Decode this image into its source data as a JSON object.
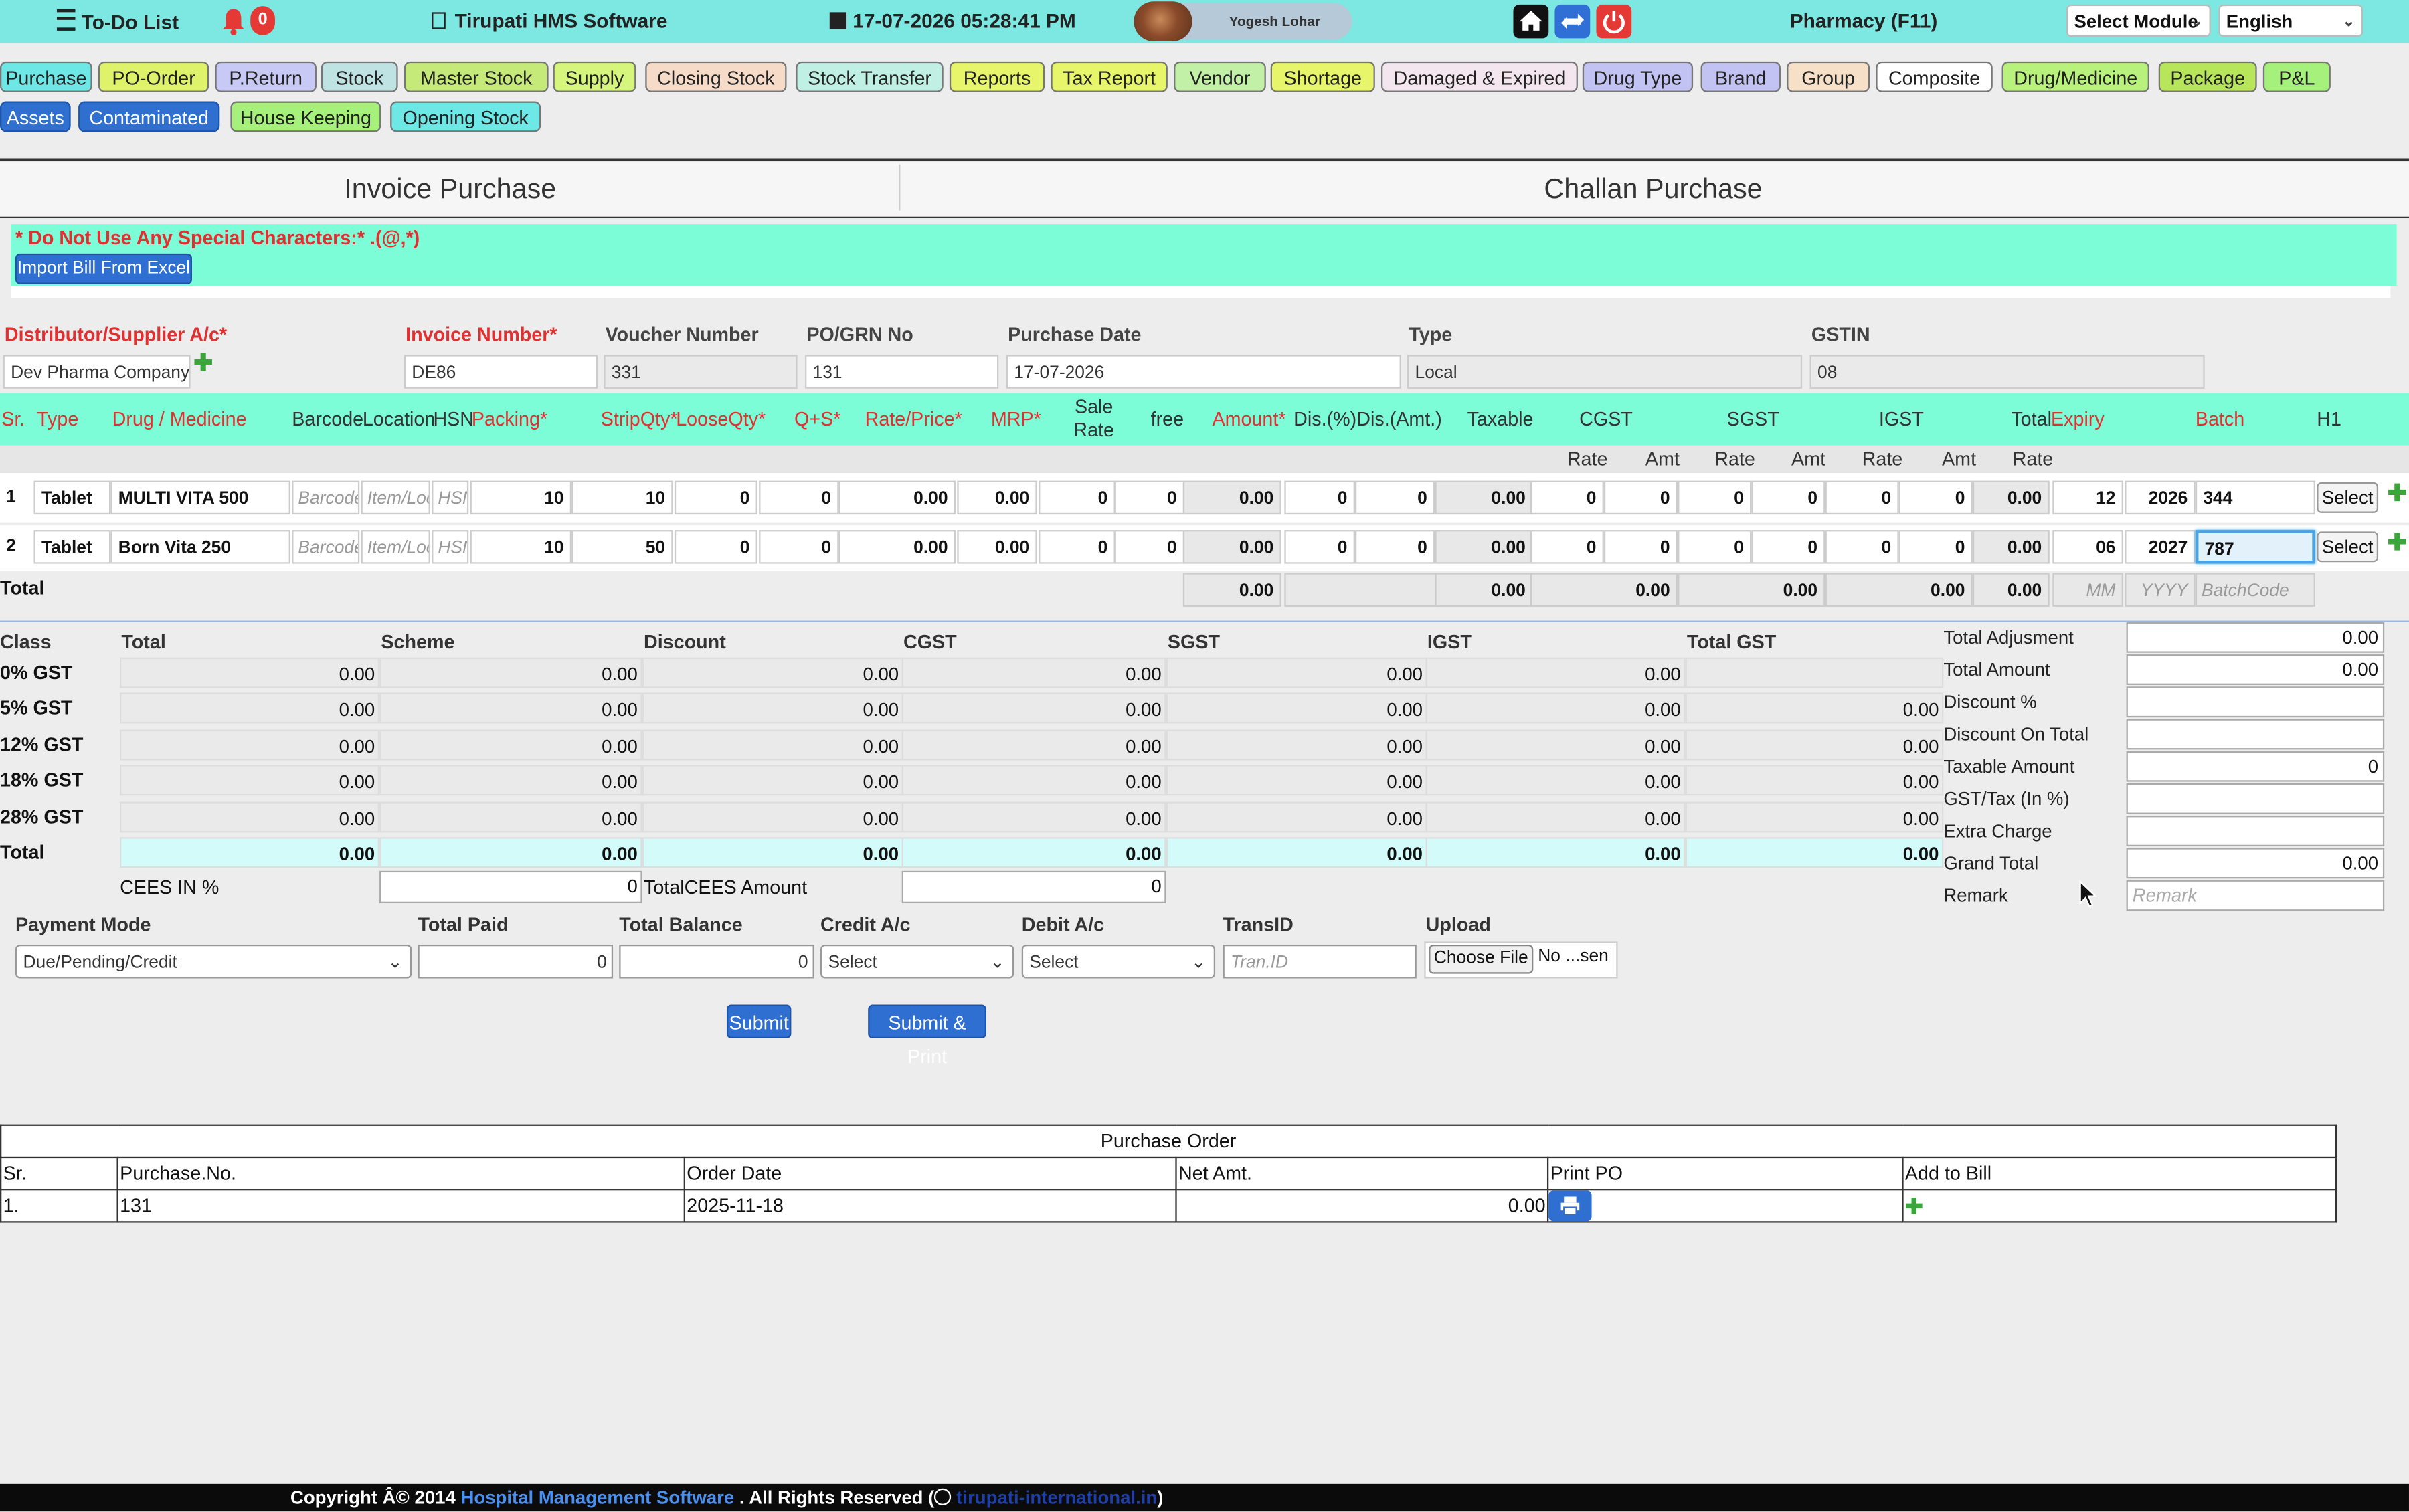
{
  "topbar": {
    "todo_label": "To-Do List",
    "notif_count": "0",
    "app_name": "Tirupati HMS Software",
    "datetime": "17-07-2026 05:28:41 PM",
    "user_name": "Yogesh Lohar",
    "module_title": "Pharmacy (F11)",
    "select_module": "Select Module",
    "language": "English"
  },
  "nav": {
    "row1": [
      {
        "label": "Purchase",
        "color": "#6ee8e6"
      },
      {
        "label": "PO-Order",
        "color": "#dff36a"
      },
      {
        "label": "P.Return",
        "color": "#c9c9f5"
      },
      {
        "label": "Stock",
        "color": "#bfe3e3"
      },
      {
        "label": "Master Stock",
        "color": "#c6ea7a"
      },
      {
        "label": "Supply",
        "color": "#d6f57c"
      },
      {
        "label": "Closing Stock",
        "color": "#f6dcc8"
      },
      {
        "label": "Stock Transfer",
        "color": "#bff0e3"
      },
      {
        "label": "Reports",
        "color": "#e6f56a"
      },
      {
        "label": "Tax Report",
        "color": "#e6f56a"
      },
      {
        "label": "Vendor",
        "color": "#c2f0a6"
      },
      {
        "label": "Shortage",
        "color": "#e6f56a"
      },
      {
        "label": "Damaged & Expired",
        "color": "#f3e6ef"
      },
      {
        "label": "Drug Type",
        "color": "#c3c3f3"
      },
      {
        "label": "Brand",
        "color": "#c3c3f3"
      },
      {
        "label": "Group",
        "color": "#f6e0c8"
      },
      {
        "label": "Composite",
        "color": "#ffffff"
      },
      {
        "label": "Drug/Medicine",
        "color": "#b8f27c"
      },
      {
        "label": "Package",
        "color": "#b8e65a"
      },
      {
        "label": "P&L",
        "color": "#a6f07c"
      }
    ],
    "row2": [
      {
        "label": "Assets",
        "color": "#2f6fcf"
      },
      {
        "label": "Contaminated",
        "color": "#2f6fcf"
      },
      {
        "label": "House Keeping",
        "color": "#a6f07c"
      },
      {
        "label": "Opening Stock",
        "color": "#6ee8e6"
      }
    ]
  },
  "tabs": {
    "invoice": "Invoice Purchase",
    "challan": "Challan Purchase"
  },
  "notice": {
    "text": "* Do Not Use Any Special Characters:* .(@,*)",
    "import_btn": "Import Bill From Excel"
  },
  "form": {
    "distributor_label": "Distributor/Supplier A/c*",
    "distributor_value": "Dev Pharma Company P",
    "invoice_label": "Invoice Number*",
    "invoice_value": "DE86",
    "voucher_label": "Voucher Number",
    "voucher_value": "331",
    "po_label": "PO/GRN No",
    "po_value": "131",
    "date_label": "Purchase Date",
    "date_value": "17-07-2026",
    "type_label": "Type",
    "type_value": "Local",
    "gstin_label": "GSTIN",
    "gstin_value": "08"
  },
  "grid": {
    "headers": {
      "sr": "Sr.",
      "type": "Type",
      "drug": "Drug / Medicine",
      "barcode": "Barcode",
      "location": "Location",
      "hsn": "HSN",
      "packing": "Packing*",
      "strip": "StripQty*",
      "loose": "LooseQty*",
      "qs": "Q+S*",
      "rate": "Rate/Price*",
      "mrp": "MRP*",
      "sale_rate": "Sale Rate",
      "free": "free",
      "amount": "Amount*",
      "disp": "Dis.(%)",
      "disamt": "Dis.(Amt.)",
      "taxable": "Taxable",
      "cgst": "CGST",
      "sgst": "SGST",
      "igst": "IGST",
      "total": "Total",
      "expiry": "Expiry",
      "batch": "Batch",
      "h1": "H1",
      "rate_sub": "Rate",
      "amt_sub": "Amt"
    },
    "placeholders": {
      "barcode": "Barcode",
      "location": "Item/Loc",
      "hsn": "HSN"
    },
    "select_label": "Select",
    "rows": [
      {
        "sr": "1",
        "type": "Tablet",
        "drug": "MULTI VITA 500",
        "packing": "10",
        "strip": "10",
        "loose": "0",
        "qs": "0",
        "rate": "0.00",
        "mrp": "0.00",
        "sale": "0",
        "free": "0",
        "amount": "0.00",
        "disp": "0",
        "disamt": "0",
        "taxable": "0.00",
        "cgst_rate": "0",
        "cgst_amt": "0",
        "sgst_rate": "0",
        "sgst_amt": "0",
        "igst_rate": "0",
        "igst_amt": "0",
        "total": "0.00",
        "exp_mm": "12",
        "exp_yyyy": "2026",
        "batch": "344"
      },
      {
        "sr": "2",
        "type": "Tablet",
        "drug": "Born Vita 250",
        "packing": "10",
        "strip": "50",
        "loose": "0",
        "qs": "0",
        "rate": "0.00",
        "mrp": "0.00",
        "sale": "0",
        "free": "0",
        "amount": "0.00",
        "disp": "0",
        "disamt": "0",
        "taxable": "0.00",
        "cgst_rate": "0",
        "cgst_amt": "0",
        "sgst_rate": "0",
        "sgst_amt": "0",
        "igst_rate": "0",
        "igst_amt": "0",
        "total": "0.00",
        "exp_mm": "06",
        "exp_yyyy": "2027",
        "batch": "787"
      }
    ],
    "totals": {
      "label": "Total",
      "amount": "0.00",
      "disamt": "0.00",
      "taxable": "0.00",
      "cgst": "0.00",
      "sgst": "0.00",
      "igst": "0.00",
      "total": "0.00",
      "mm_ph": "MM",
      "yyyy_ph": "YYYY",
      "batch_ph": "BatchCode"
    }
  },
  "gst_table": {
    "headers": {
      "class": "Class",
      "total": "Total",
      "scheme": "Scheme",
      "discount": "Discount",
      "cgst": "CGST",
      "sgst": "SGST",
      "igst": "IGST",
      "total_gst": "Total GST"
    },
    "rows": [
      {
        "class": "0% GST",
        "total": "0.00",
        "scheme": "0.00",
        "discount": "0.00",
        "cgst": "0.00",
        "sgst": "0.00",
        "igst": "0.00",
        "total_gst": ""
      },
      {
        "class": "5% GST",
        "total": "0.00",
        "scheme": "0.00",
        "discount": "0.00",
        "cgst": "0.00",
        "sgst": "0.00",
        "igst": "0.00",
        "total_gst": "0.00"
      },
      {
        "class": "12% GST",
        "total": "0.00",
        "scheme": "0.00",
        "discount": "0.00",
        "cgst": "0.00",
        "sgst": "0.00",
        "igst": "0.00",
        "total_gst": "0.00"
      },
      {
        "class": "18% GST",
        "total": "0.00",
        "scheme": "0.00",
        "discount": "0.00",
        "cgst": "0.00",
        "sgst": "0.00",
        "igst": "0.00",
        "total_gst": "0.00"
      },
      {
        "class": "28% GST",
        "total": "0.00",
        "scheme": "0.00",
        "discount": "0.00",
        "cgst": "0.00",
        "sgst": "0.00",
        "igst": "0.00",
        "total_gst": "0.00"
      }
    ],
    "total_row": {
      "class": "Total",
      "total": "0.00",
      "scheme": "0.00",
      "discount": "0.00",
      "cgst": "0.00",
      "sgst": "0.00",
      "igst": "0.00",
      "total_gst": "0.00"
    },
    "cees_label": "CEES IN %",
    "cees_value": "0",
    "total_cees_label": "TotalCEES Amount",
    "total_cees_value": "0"
  },
  "summary": [
    {
      "label": "Total Adjusment",
      "value": "0.00"
    },
    {
      "label": "Total Amount",
      "value": "0.00"
    },
    {
      "label": "Discount %",
      "value": ""
    },
    {
      "label": "Discount On Total",
      "value": ""
    },
    {
      "label": "Taxable Amount",
      "value": "0"
    },
    {
      "label": "GST/Tax (In %)",
      "value": ""
    },
    {
      "label": "Extra Charge",
      "value": ""
    },
    {
      "label": "Grand Total",
      "value": "0.00"
    },
    {
      "label": "Remark",
      "value": ""
    }
  ],
  "remark_placeholder": "Remark",
  "payment": {
    "mode_label": "Payment Mode",
    "mode_value": "Due/Pending/Credit",
    "paid_label": "Total Paid",
    "paid_value": "0",
    "balance_label": "Total Balance",
    "balance_value": "0",
    "credit_label": "Credit A/c",
    "credit_value": "Select",
    "debit_label": "Debit A/c",
    "debit_value": "Select",
    "trans_label": "TransID",
    "trans_placeholder": "Tran.ID",
    "upload_label": "Upload",
    "choose_file": "Choose File",
    "file_status": "No ...sen"
  },
  "buttons": {
    "submit": "Submit",
    "submit_print": "Submit & Print"
  },
  "purchase_order": {
    "title": "Purchase Order",
    "headers": [
      "Sr.",
      "Purchase.No.",
      "Order Date",
      "Net Amt.",
      "Print PO",
      "Add to Bill"
    ],
    "rows": [
      {
        "sr": "1.",
        "no": "131",
        "date": "2025-11-18",
        "amt": "0.00"
      }
    ]
  },
  "footer": {
    "text": "Copyright Â© 2014",
    "link1": "Hospital Management Software",
    "text2": ". All Rights Reserved (",
    "link2": "tirupati-international.in",
    "text3": ")"
  }
}
